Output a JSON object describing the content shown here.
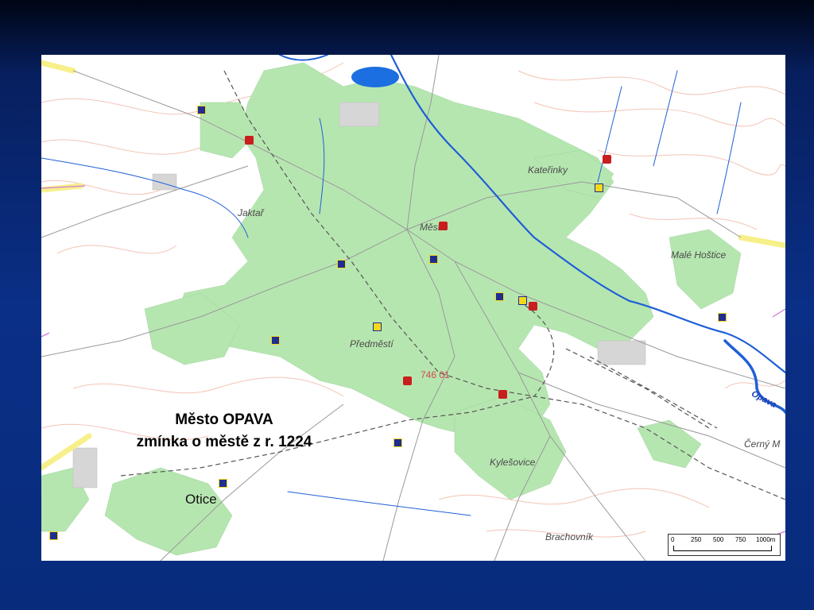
{
  "caption": {
    "line1": "Město OPAVA",
    "line2": "zmínka o městě z r. 1224"
  },
  "map": {
    "places": {
      "jaktar": "Jaktař",
      "katerinky": "Kateřinky",
      "mesto": "Město",
      "male_hostice": "Malé Hoštice",
      "predmesti": "Předměstí",
      "kylesovice": "Kylešovice",
      "otice": "Otice",
      "cerny_mlyn": "Černý M",
      "brachovnik": "Brachovník",
      "river_opava": "Opava"
    },
    "postal_code": "746 01",
    "scale": {
      "labels": [
        "0",
        "250",
        "500",
        "750",
        "1000m"
      ]
    },
    "colors": {
      "built_up": "#b6e6b0",
      "river": "#1f5fd6",
      "lake": "#1b6fe0",
      "contour": "#f3c4b6",
      "road_main": "#f7f08a"
    }
  }
}
